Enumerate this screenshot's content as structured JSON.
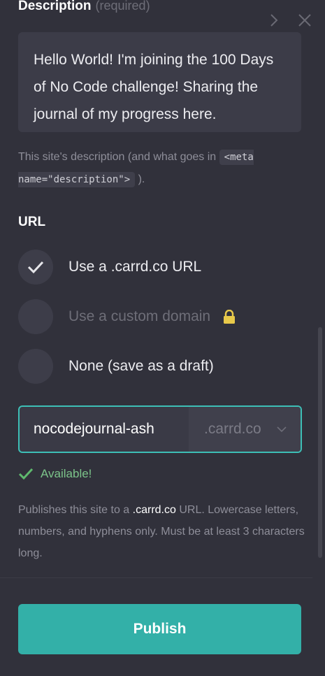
{
  "header": {
    "next_icon": "chevron-right-icon",
    "close_icon": "close-icon"
  },
  "description": {
    "label": "Description",
    "required_text": "(required)",
    "value": "Hello World! I'm joining the 100 Days of No Code challenge! Sharing the journal of my progress here.",
    "help_prefix": "This site's description (and what goes in ",
    "help_code": "<meta name=\"description\">",
    "help_suffix": " )."
  },
  "url": {
    "label": "URL",
    "options": [
      {
        "label": "Use a .carrd.co URL",
        "selected": true,
        "disabled": false
      },
      {
        "label": "Use a custom domain",
        "selected": false,
        "disabled": true
      },
      {
        "label": "None (save as a draft)",
        "selected": false,
        "disabled": false
      }
    ],
    "subdomain_value": "nocodejournal-ash",
    "domain_suffix": ".carrd.co",
    "status_text": "Available!",
    "help_prefix": "Publishes this site to a ",
    "help_highlight": ".carrd.co",
    "help_suffix": " URL. Lowercase letters, numbers, and hyphens only. Must be at least 3 characters long."
  },
  "actions": {
    "publish_label": "Publish"
  },
  "colors": {
    "accent": "#33b0a8",
    "background": "#31313b",
    "success": "#7cc48a",
    "lock": "#e8c94a"
  }
}
